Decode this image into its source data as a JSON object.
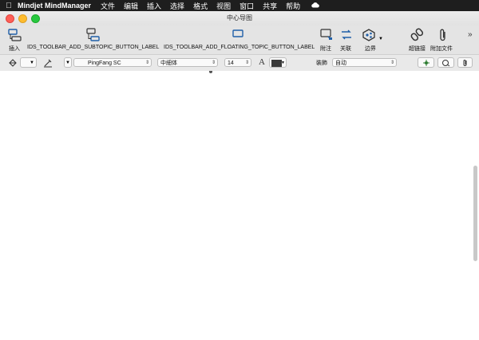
{
  "menubar": {
    "app_name": "Mindjet MindManager",
    "items": [
      "文件",
      "编辑",
      "插入",
      "选择",
      "格式",
      "视图",
      "窗口",
      "共享",
      "帮助"
    ]
  },
  "window": {
    "title": "中心导图"
  },
  "toolbar": {
    "insert_label": "插入",
    "subtopic_label": "IDS_TOOLBAR_ADD_SUBTOPIC_BUTTON_LABEL",
    "floating_label": "IDS_TOOLBAR_ADD_FLOATING_TOPIC_BUTTON_LABEL",
    "note_label": "附注",
    "relation_label": "关联",
    "boundary_label": "边界",
    "hyperlink_label": "超链接",
    "attach_label": "附加文件",
    "overflow_label": "»"
  },
  "formatbar": {
    "font_family": "PingFang SC",
    "font_style": "中細体",
    "font_size": "14",
    "font_glyph": "A",
    "autofit_label": "裝飾",
    "autofit_value": "自动",
    "text_color": "#3a3a3a",
    "accent_color": "#2e7d32"
  }
}
